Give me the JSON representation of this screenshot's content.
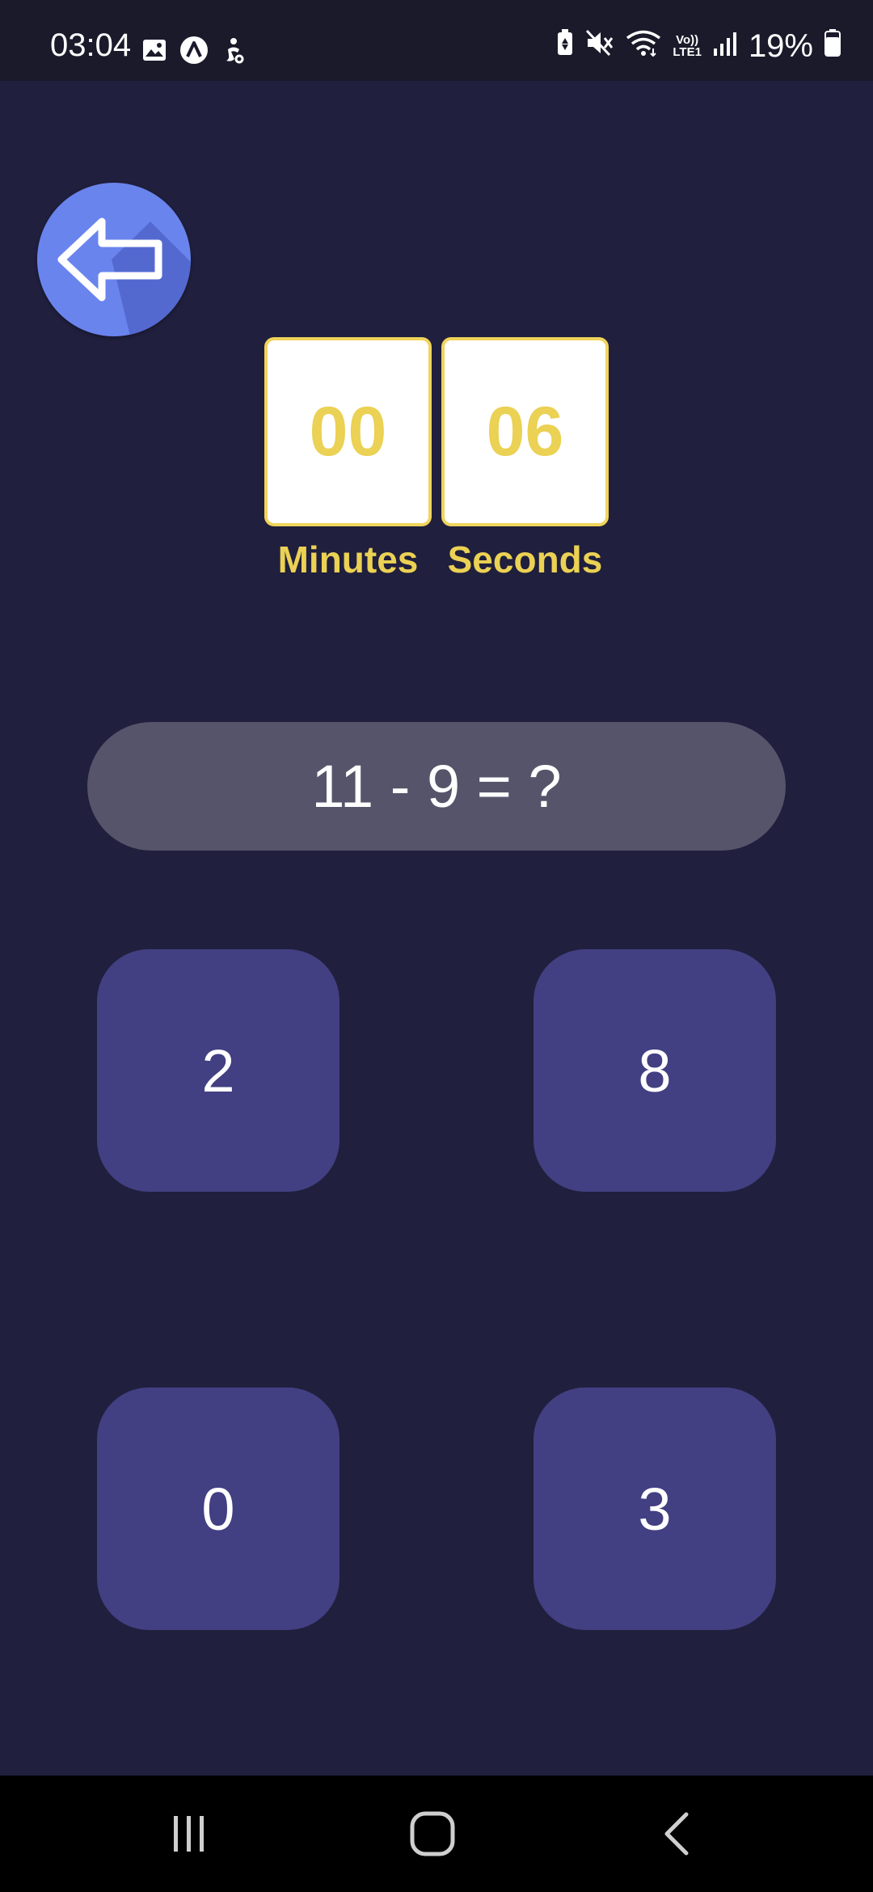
{
  "status_bar": {
    "time": "03:04",
    "battery_percent": "19%",
    "network_label_top": "Vo))",
    "network_label_bottom": "LTE1",
    "left_icons": [
      "gallery-icon",
      "app-a-icon",
      "accessibility-icon"
    ],
    "right_icons": [
      "battery-saver-icon",
      "mute-icon",
      "wifi-icon",
      "volte-icon",
      "signal-icon",
      "battery-icon"
    ]
  },
  "timer": {
    "minutes": "00",
    "seconds": "06",
    "minutes_label": "Minutes",
    "seconds_label": "Seconds"
  },
  "question": {
    "text": "11 - 9 = ?"
  },
  "answers": [
    {
      "label": "2"
    },
    {
      "label": "8"
    },
    {
      "label": "0"
    },
    {
      "label": "3"
    }
  ],
  "colors": {
    "background": "#201f3d",
    "accent_yellow": "#ebd154",
    "answer_button": "#423f82",
    "question_bar": "#55546a",
    "back_button": "#6a84ee"
  },
  "icons": {
    "back": "left-arrow-icon",
    "nav_recent": "recent-apps-icon",
    "nav_home": "home-icon",
    "nav_back": "back-chevron-icon"
  }
}
